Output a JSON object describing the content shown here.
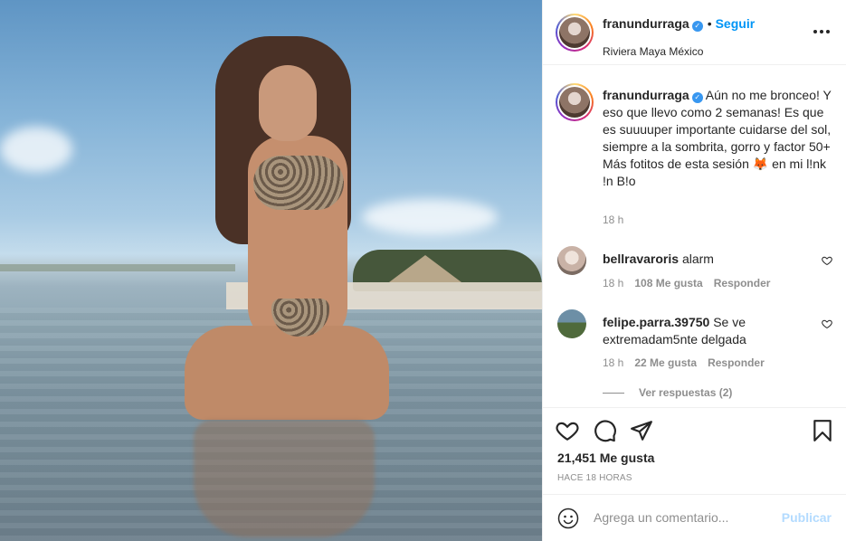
{
  "post": {
    "username": "franundurraga",
    "follow_label": "Seguir",
    "separator": "•",
    "location": "Riviera Maya México",
    "more_label": "•••",
    "verified_mark": "✓",
    "photo_icon": "beach-photo"
  },
  "caption": {
    "username": "franundurraga",
    "text": " Aún no me bronceo! Y eso que llevo como 2 semanas! Es que es suuuuper importante cuidarse del sol, siempre a la sombrita, gorro y factor 50+\nMás fotitos de esta sesión 🦊 en mi l!nk !n B!o",
    "time": "18 h"
  },
  "comments": [
    {
      "username": "bellravaroris",
      "text": "alarm",
      "time": "18 h",
      "likes": "108 Me gusta",
      "reply": "Responder"
    },
    {
      "username": "felipe.parra.39750",
      "text": "Se ve extremadam5nte delgada",
      "time": "18 h",
      "likes": "22 Me gusta",
      "reply": "Responder"
    }
  ],
  "view_replies": "Ver respuestas (2)",
  "actions": {
    "likes": "21,451 Me gusta",
    "ago": "HACE 18 HORAS",
    "icons": [
      "heart-icon",
      "comment-icon",
      "share-icon",
      "bookmark-icon"
    ]
  },
  "add_comment": {
    "placeholder": "Agrega un comentario...",
    "publish_label": "Publicar"
  },
  "colors": {
    "accent": "#0095f6",
    "publish_disabled": "#b3dbff",
    "muted": "#8e8e8e",
    "text": "#262626"
  }
}
